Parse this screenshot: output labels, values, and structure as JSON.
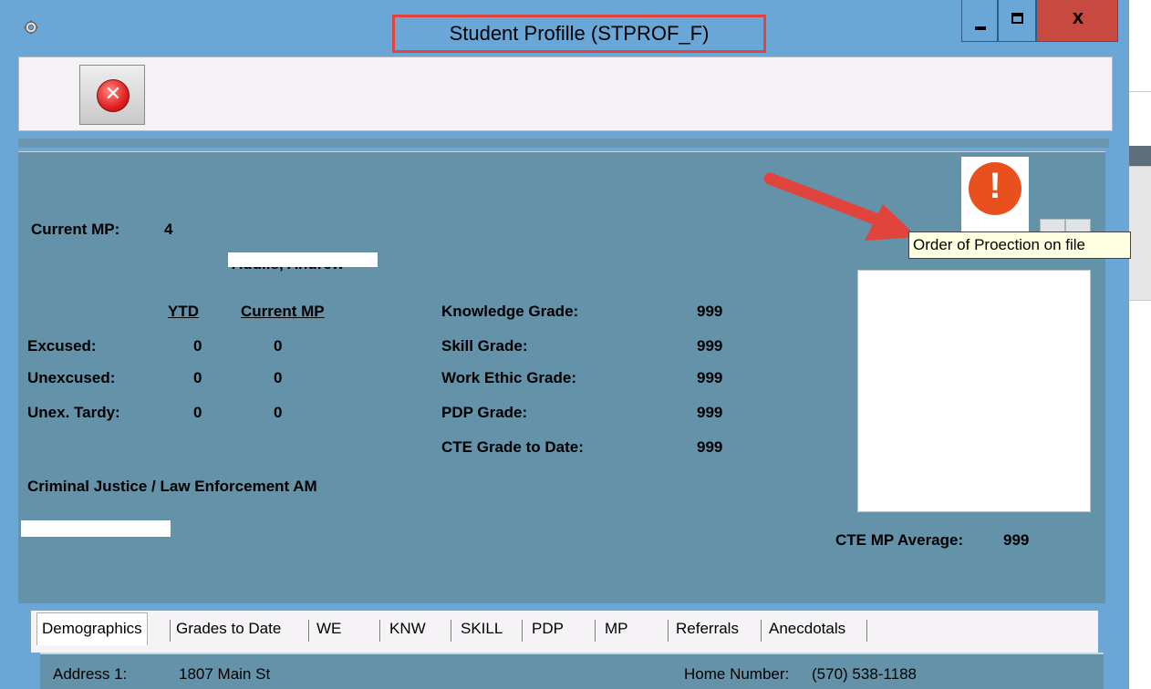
{
  "window": {
    "title": "Student Profille (STPROF_F)",
    "close_glyph": "x"
  },
  "toolbar": {
    "close_button_glyph": "✕"
  },
  "header": {
    "current_mp_label": "Current MP:",
    "current_mp_value": "4",
    "student_name": "Addiis, Andrew"
  },
  "attendance": {
    "col_ytd": "YTD",
    "col_current_mp": "Current MP",
    "rows": [
      {
        "label": "Excused:",
        "ytd": "0",
        "current": "0"
      },
      {
        "label": "Unexcused:",
        "ytd": "0",
        "current": "0"
      },
      {
        "label": "Unex. Tardy:",
        "ytd": "0",
        "current": "0"
      }
    ]
  },
  "grades": {
    "rows": [
      {
        "label": "Knowledge Grade:",
        "value": "999"
      },
      {
        "label": "Skill Grade:",
        "value": "999"
      },
      {
        "label": "Work Ethic Grade:",
        "value": "999"
      },
      {
        "label": "PDP Grade:",
        "value": "999"
      },
      {
        "label": "CTE Grade to Date:",
        "value": "999"
      }
    ]
  },
  "program": "Criminal Justice / Law Enforcement AM",
  "cte_average": {
    "label": "CTE MP Average:",
    "value": "999"
  },
  "alert": {
    "icon": "exclamation-alert-icon",
    "glyph": "!",
    "tooltip": "Order of Proection on file"
  },
  "tabs": [
    "Demographics",
    "Grades to Date",
    "WE",
    "KNW",
    "SKILL",
    "PDP",
    "MP",
    "Referrals",
    "Anecdotals"
  ],
  "demographics": {
    "address_label": "Address 1:",
    "address_value": "1807 Main St",
    "phone_label": "Home Number:",
    "phone_value": "(570) 538-1188"
  },
  "colors": {
    "title_bar": "#6aa7d6",
    "panel": "#6392a9",
    "close_button": "#c8493f",
    "alert": "#e8501e",
    "annotation": "#e0443c"
  }
}
